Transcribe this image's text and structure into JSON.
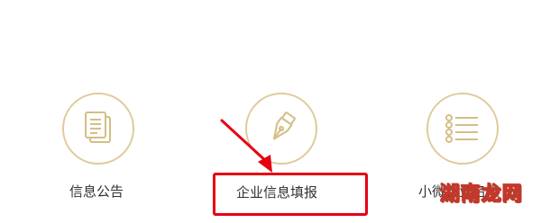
{
  "menu": {
    "items": [
      {
        "label": "信息公告",
        "icon": "document-stack-icon"
      },
      {
        "label": "企业信息填报",
        "icon": "pen-nib-icon"
      },
      {
        "label": "小微企业名录",
        "icon": "list-icon"
      }
    ]
  },
  "annotation": {
    "watermark": "湖南龙网",
    "accent_color": "#dfcb9b",
    "highlight_color": "#e60012"
  }
}
